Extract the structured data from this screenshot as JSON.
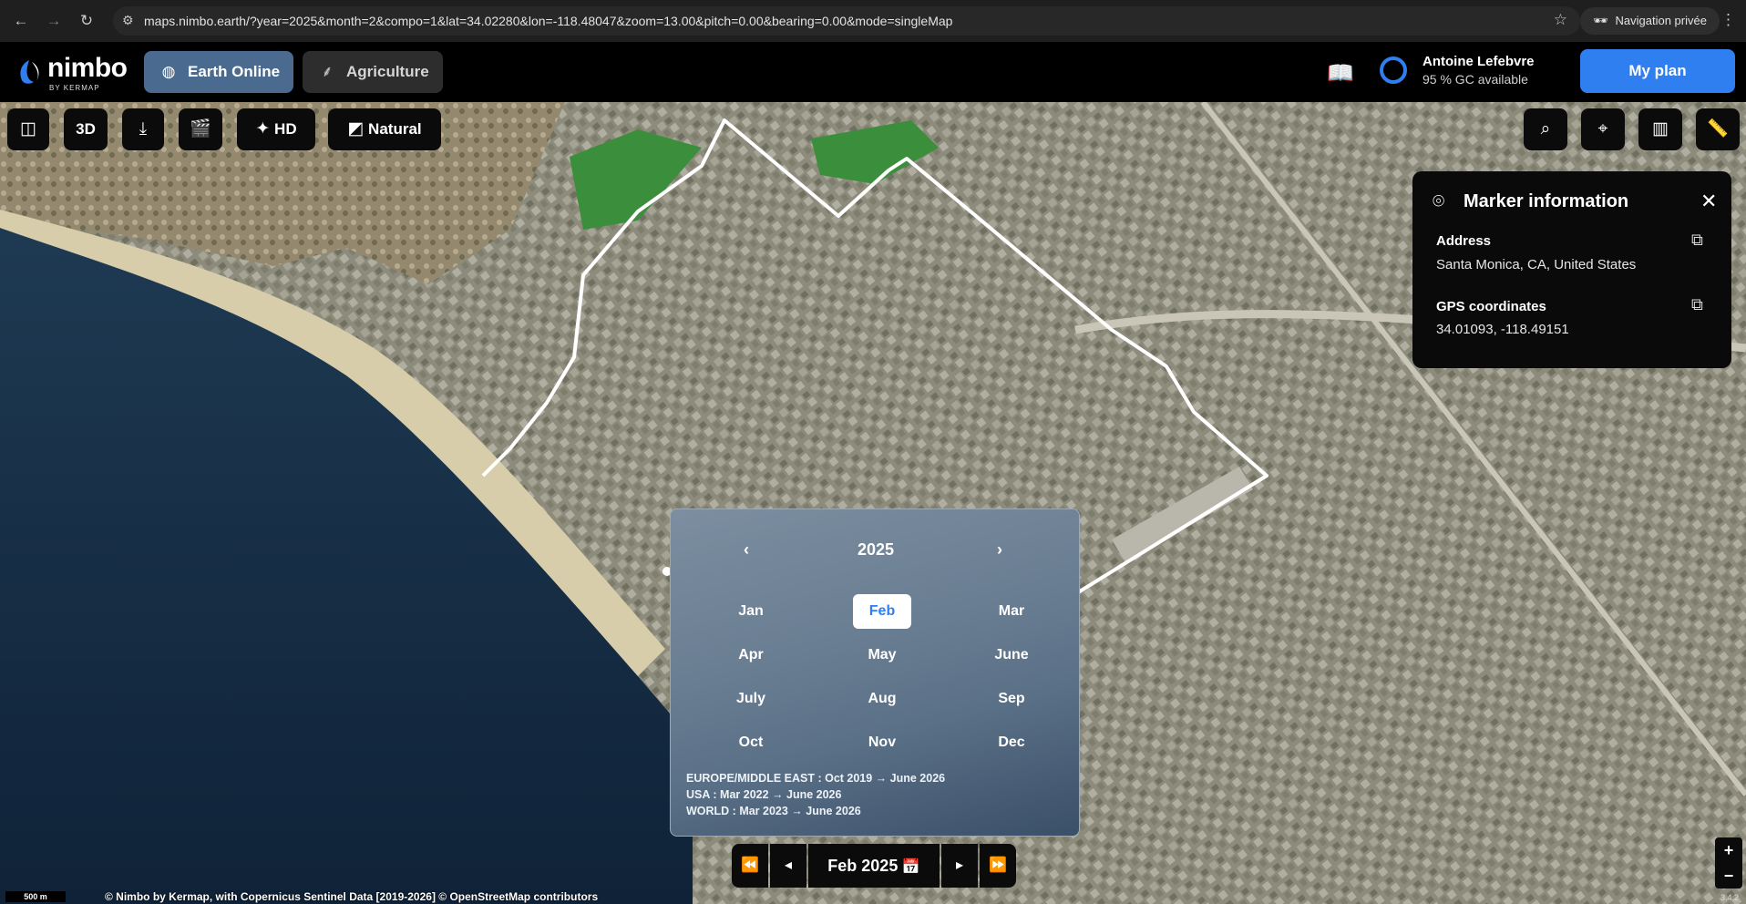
{
  "browser": {
    "url": "maps.nimbo.earth/?year=2025&month=2&compo=1&lat=34.02280&lon=-118.48047&zoom=13.00&pitch=0.00&bearing=0.00&mode=singleMap",
    "private_label": "Navigation privée",
    "icons": [
      "back-icon",
      "forward-icon",
      "reload-icon",
      "site-settings-icon",
      "bookmark-star-icon",
      "incognito-icon",
      "menu-icon"
    ]
  },
  "app": {
    "logo_name": "nimbo",
    "logo_sub": "BY KERMAP",
    "modes": [
      {
        "label": "Earth Online",
        "icon": "globe-icon",
        "active": true
      },
      {
        "label": "Agriculture",
        "icon": "wheat-icon",
        "active": false
      }
    ],
    "user": {
      "name": "Antoine Lefebvre",
      "credit": "95 % GC available"
    },
    "plan_button": "My plan"
  },
  "toolbar": {
    "compare_icon": "split-view-icon",
    "three_d": "3D",
    "download_icon": "download-icon",
    "clapper_icon": "clapperboard-icon",
    "hd": "HD",
    "natural": "Natural",
    "right_icons": [
      "search-icon",
      "locate-icon",
      "map-layers-icon",
      "ruler-icon"
    ]
  },
  "marker_panel": {
    "title": "Marker information",
    "address_label": "Address",
    "address_value": "Santa Monica, CA, United States",
    "gps_label": "GPS coordinates",
    "gps_value": "34.01093, -118.49151"
  },
  "picker": {
    "year": "2025",
    "selected": "Feb",
    "months": [
      "Jan",
      "Feb",
      "Mar",
      "Apr",
      "May",
      "June",
      "July",
      "Aug",
      "Sep",
      "Oct",
      "Nov",
      "Dec"
    ],
    "coverage": [
      "EUROPE/MIDDLE EAST : Oct 2019 → June 2026",
      "USA : Mar 2022 → June 2026",
      "WORLD : Mar 2023 → June 2026"
    ]
  },
  "datenav": {
    "current": "Feb 2025"
  },
  "map": {
    "scale": "500 m",
    "attribution": "© Nimbo by Kermap, with Copernicus Sentinel Data [2019-2026] © OpenStreetMap contributors",
    "version": "3.4.2",
    "colors": {
      "ocean": "#14283f",
      "beach": "#d8cdaa",
      "land": "#8c8a79",
      "park": "#3b8f3c",
      "boundary": "#ffffff"
    }
  }
}
